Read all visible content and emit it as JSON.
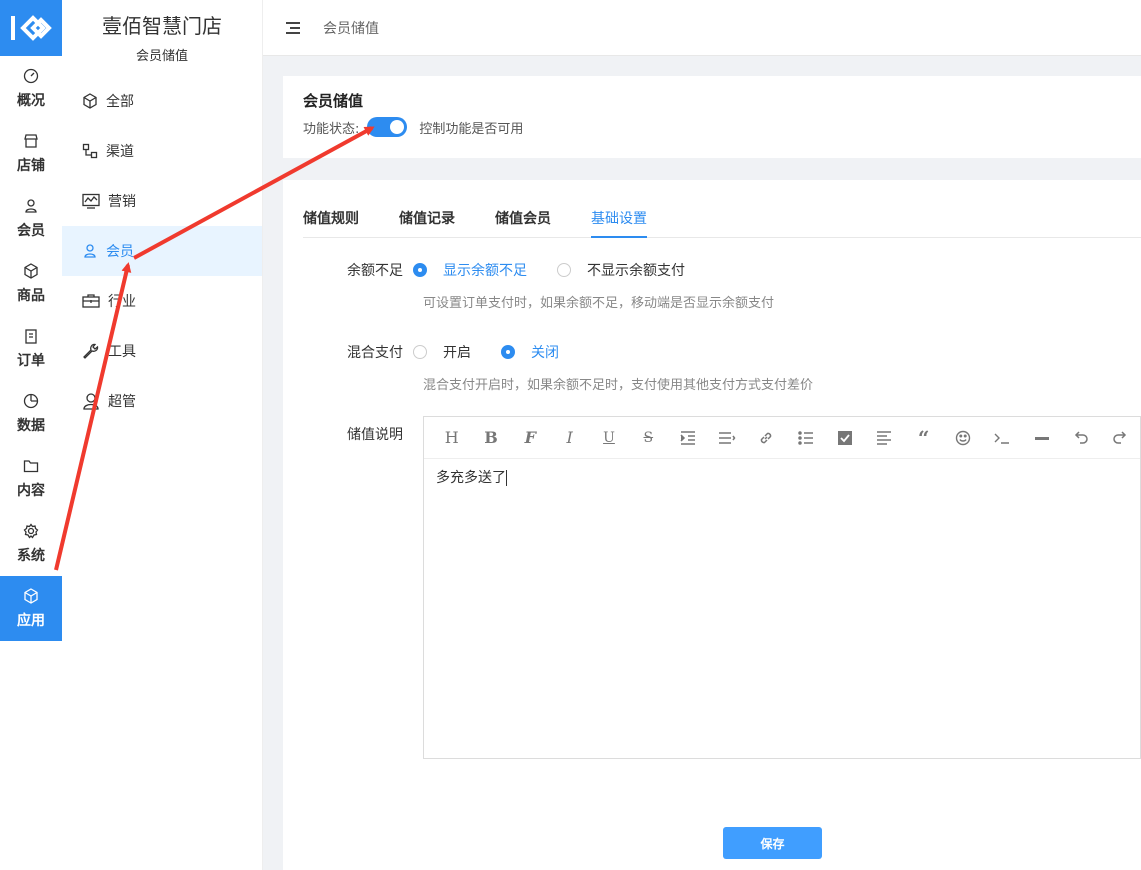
{
  "nav": {
    "logo": "logo-icon",
    "items": [
      {
        "label": "概况",
        "icon": "dashboard-icon"
      },
      {
        "label": "店铺",
        "icon": "store-icon"
      },
      {
        "label": "会员",
        "icon": "user-icon"
      },
      {
        "label": "商品",
        "icon": "box-icon"
      },
      {
        "label": "订单",
        "icon": "clipboard-icon"
      },
      {
        "label": "数据",
        "icon": "pie-chart-icon"
      },
      {
        "label": "内容",
        "icon": "folder-icon"
      },
      {
        "label": "系统",
        "icon": "gear-icon"
      },
      {
        "label": "应用",
        "icon": "cube-icon",
        "active": true
      }
    ]
  },
  "sidebar": {
    "store_name": "壹佰智慧门店",
    "section": "会员储值",
    "items": [
      {
        "label": "全部",
        "icon": "cube-icon"
      },
      {
        "label": "渠道",
        "icon": "channel-icon"
      },
      {
        "label": "营销",
        "icon": "trend-chart-icon"
      },
      {
        "label": "会员",
        "icon": "user-icon",
        "active": true
      },
      {
        "label": "行业",
        "icon": "briefcase-icon"
      },
      {
        "label": "工具",
        "icon": "wrench-icon"
      },
      {
        "label": "超管",
        "icon": "admin-icon"
      }
    ]
  },
  "header": {
    "breadcrumb": "会员储值"
  },
  "feature": {
    "title": "会员储值",
    "status_label": "功能状态:",
    "enabled": true,
    "status_hint": "控制功能是否可用"
  },
  "tabs": [
    {
      "label": "储值规则"
    },
    {
      "label": "储值记录"
    },
    {
      "label": "储值会员"
    },
    {
      "label": "基础设置",
      "active": true
    }
  ],
  "form": {
    "balance": {
      "label": "余额不足",
      "options": [
        "显示余额不足",
        "不显示余额支付"
      ],
      "selected": "显示余额不足",
      "hint": "可设置订单支付时，如果余额不足，移动端是否显示余额支付"
    },
    "mixed": {
      "label": "混合支付",
      "options": [
        "开启",
        "关闭"
      ],
      "selected": "关闭",
      "hint": "混合支付开启时，如果余额不足时，支付使用其他支付方式支付差价"
    },
    "description": {
      "label": "储值说明",
      "content": "多充多送了"
    }
  },
  "editor_toolbar": [
    "heading-icon",
    "bold-icon",
    "font-icon",
    "italic-icon",
    "underline-icon",
    "strikethrough-icon",
    "indent-icon",
    "align-icon",
    "link-icon",
    "list-icon",
    "checkbox-icon",
    "justify-icon",
    "quote-icon",
    "emoji-icon",
    "code-icon",
    "divider-icon",
    "undo-icon",
    "redo-icon"
  ],
  "actions": {
    "save_label": "保存"
  },
  "colors": {
    "accent": "#2d8cf0",
    "annotation": "#f03a2e"
  }
}
